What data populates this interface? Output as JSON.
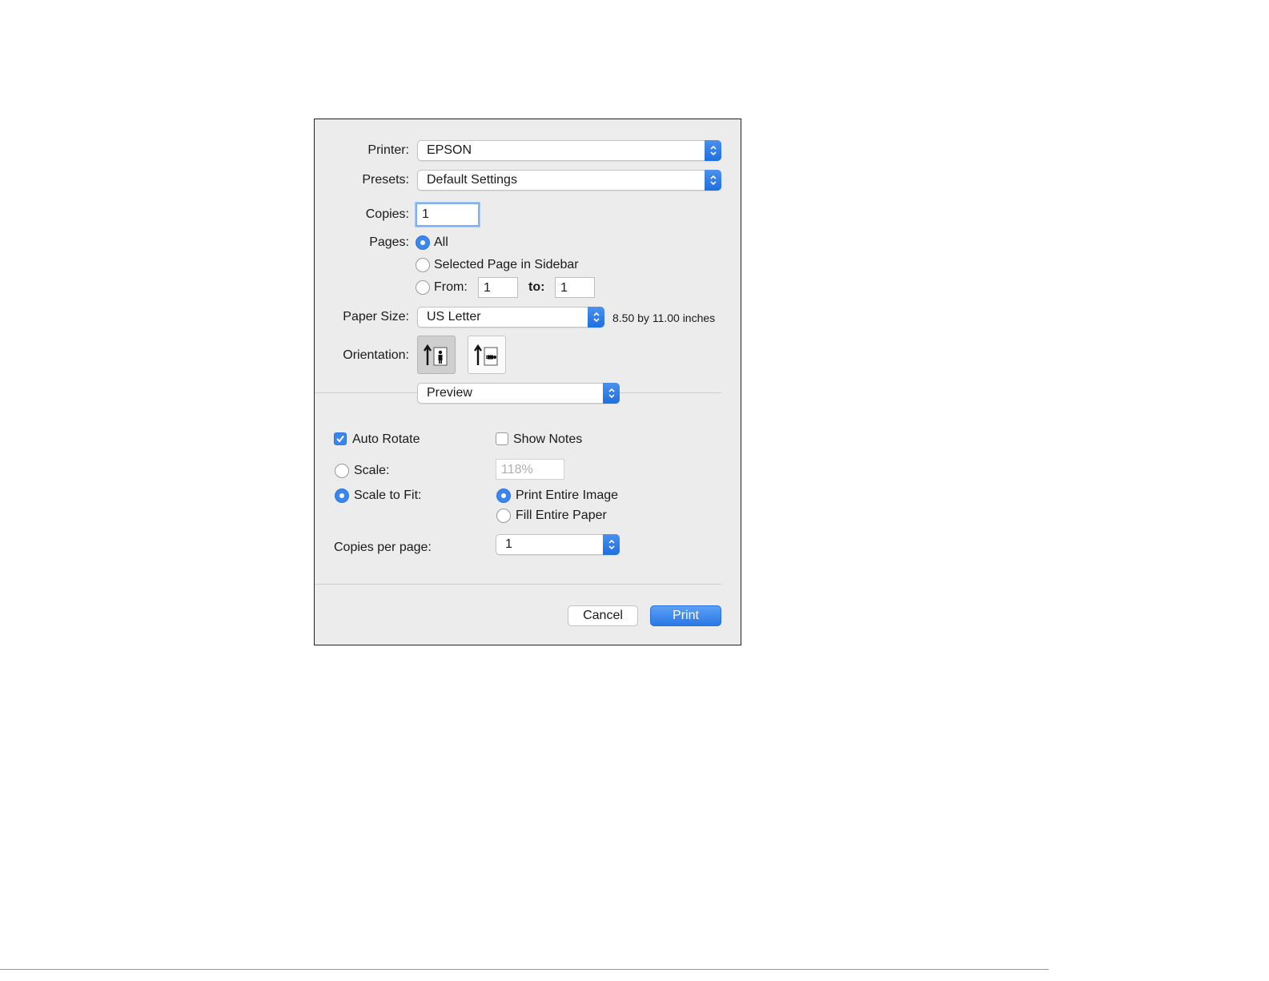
{
  "printer": {
    "label": "Printer:",
    "value": "EPSON"
  },
  "presets": {
    "label": "Presets:",
    "value": "Default Settings"
  },
  "copies": {
    "label": "Copies:",
    "value": "1"
  },
  "pages": {
    "label": "Pages:",
    "options": [
      "All",
      "Selected Page in Sidebar",
      "From:"
    ],
    "selected": "All",
    "from_value": "1",
    "to_label": "to:",
    "to_value": "1"
  },
  "paper_size": {
    "label": "Paper Size:",
    "value": "US Letter",
    "dimensions": "8.50 by 11.00 inches"
  },
  "orientation": {
    "label": "Orientation:",
    "selected": "portrait",
    "icons": [
      "portrait-orientation-icon",
      "landscape-orientation-icon"
    ]
  },
  "section_popup": {
    "value": "Preview"
  },
  "preview": {
    "auto_rotate": {
      "label": "Auto Rotate",
      "checked": true
    },
    "show_notes": {
      "label": "Show Notes",
      "checked": false
    },
    "scale": {
      "label": "Scale:",
      "value": "118%"
    },
    "scale_to_fit": {
      "label": "Scale to Fit:",
      "selected": true
    },
    "fit_options": [
      "Print Entire Image",
      "Fill Entire Paper"
    ],
    "fit_selected": "Print Entire Image",
    "copies_per_page": {
      "label": "Copies per page:",
      "value": "1"
    }
  },
  "buttons": {
    "cancel": "Cancel",
    "print": "Print"
  },
  "colors": {
    "accent": "#3b86ee",
    "dialog_bg": "#ececec"
  }
}
